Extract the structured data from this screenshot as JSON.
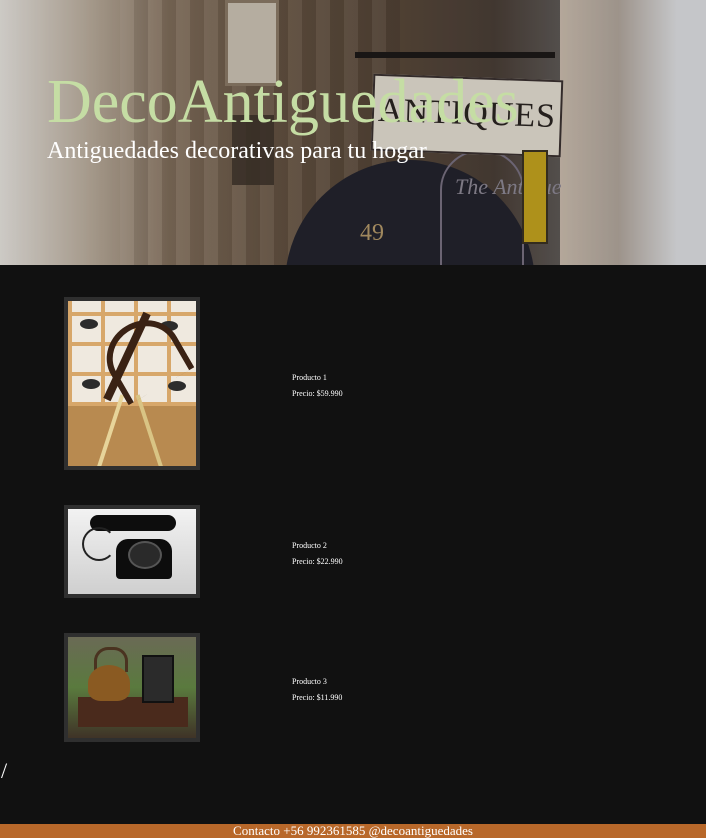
{
  "header": {
    "title": "DecoAntiguedades",
    "subtitle": "Antiguedades decorativas para tu hogar",
    "hero_sign_text": "ANTIQUES",
    "hero_number": "49",
    "hero_oval_text": "The Antique"
  },
  "products": [
    {
      "name": "Producto 1",
      "price": "Precio: $59.990",
      "image_alt": "sextant on tiled wall"
    },
    {
      "name": "Producto 2",
      "price": "Precio: $22.990",
      "image_alt": "black rotary telephone"
    },
    {
      "name": "Producto 3",
      "price": "Precio: $11.990",
      "image_alt": "copper kettle and lantern"
    }
  ],
  "stray_text": "/",
  "footer": {
    "text": "Contacto +56 992361585 @decoantiguedades"
  },
  "colors": {
    "title": "#c5dda4",
    "background": "#111111",
    "footer": "#b8682a"
  }
}
